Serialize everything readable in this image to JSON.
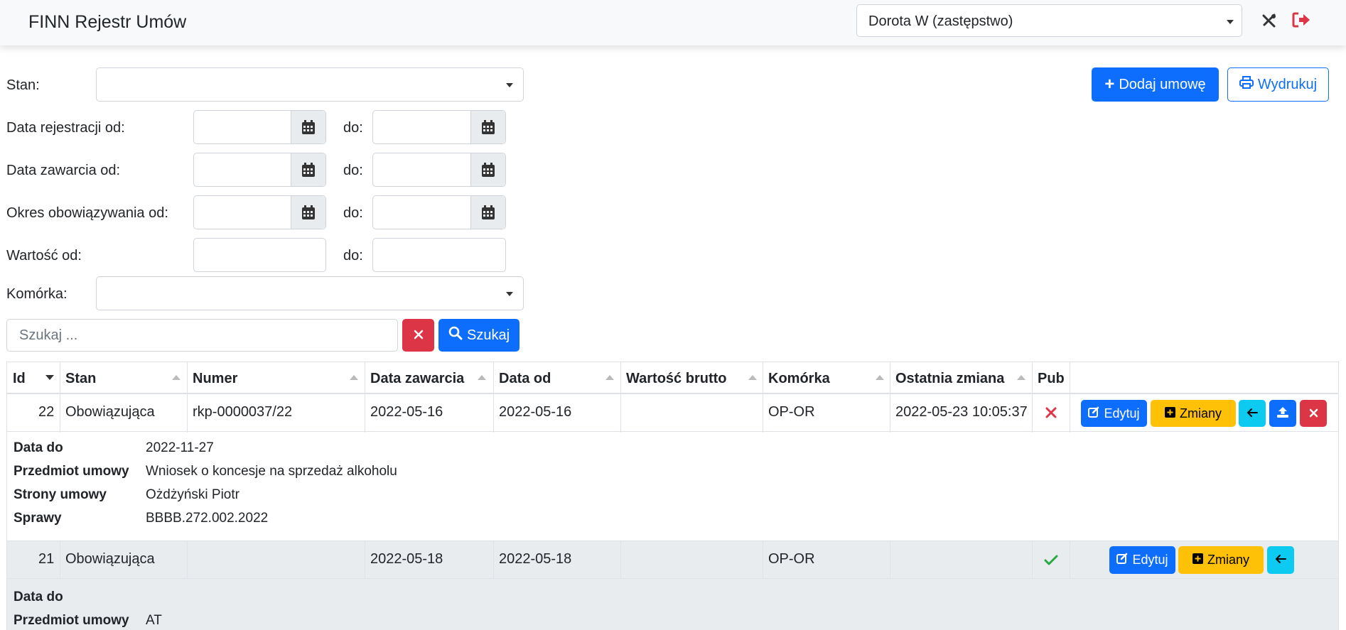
{
  "app": {
    "title": "FINN Rejestr Umów"
  },
  "navbar": {
    "user": "Dorota W (zastępstwo)",
    "tools_icon": "tools-icon",
    "logout_icon": "sign-out-icon"
  },
  "filters": {
    "stan_label": "Stan:",
    "stan_value": "",
    "data_rejestracji_label": "Data rejestracji od:",
    "data_zawarcia_label": "Data zawarcia od:",
    "okres_label": "Okres obowiązywania od:",
    "wartosc_label": "Wartość od:",
    "do_label": "do:",
    "komorka_label": "Komórka:",
    "komorka_value": ""
  },
  "actions": {
    "add_label": "Dodaj umowę",
    "print_label": "Wydrukuj"
  },
  "search": {
    "placeholder": "Szukaj ...",
    "search_label": "Szukaj"
  },
  "table": {
    "headers": [
      "Id",
      "Stan",
      "Numer",
      "Data zawarcia",
      "Data od",
      "Wartość brutto",
      "Komórka",
      "Ostatnia zmiana",
      "Pub"
    ],
    "sorted_column": "Id",
    "sort_direction": "desc",
    "rows": [
      {
        "id": "22",
        "stan": "Obowiązująca",
        "numer": "rkp-0000037/22",
        "data_zawarcia": "2022-05-16",
        "data_od": "2022-05-16",
        "wartosc": "",
        "komorka": "OP-OR",
        "ostatnia_zmiana": "2022-05-23 10:05:37",
        "pub": false,
        "buttons": {
          "edit": "Edytuj",
          "changes": "Zmiany"
        },
        "details": [
          {
            "key": "Data do",
            "value": "2022-11-27"
          },
          {
            "key": "Przedmiot umowy",
            "value": "Wniosek o koncesje na sprzedaż alkoholu"
          },
          {
            "key": "Strony umowy",
            "value": "Ożdżyński Piotr"
          },
          {
            "key": "Sprawy",
            "value": "BBBB.272.002.2022"
          }
        ]
      },
      {
        "id": "21",
        "stan": "Obowiązująca",
        "numer": "",
        "data_zawarcia": "2022-05-18",
        "data_od": "2022-05-18",
        "wartosc": "",
        "komorka": "OP-OR",
        "ostatnia_zmiana": "",
        "pub": true,
        "buttons": {
          "edit": "Edytuj",
          "changes": "Zmiany"
        },
        "details": [
          {
            "key": "Data do",
            "value": ""
          },
          {
            "key": "Przedmiot umowy",
            "value": "AT"
          }
        ]
      }
    ]
  },
  "colors": {
    "primary": "#0d6efd",
    "danger": "#dc3545",
    "warning": "#ffc107",
    "info": "#0dcaf0",
    "success": "#28a745"
  }
}
